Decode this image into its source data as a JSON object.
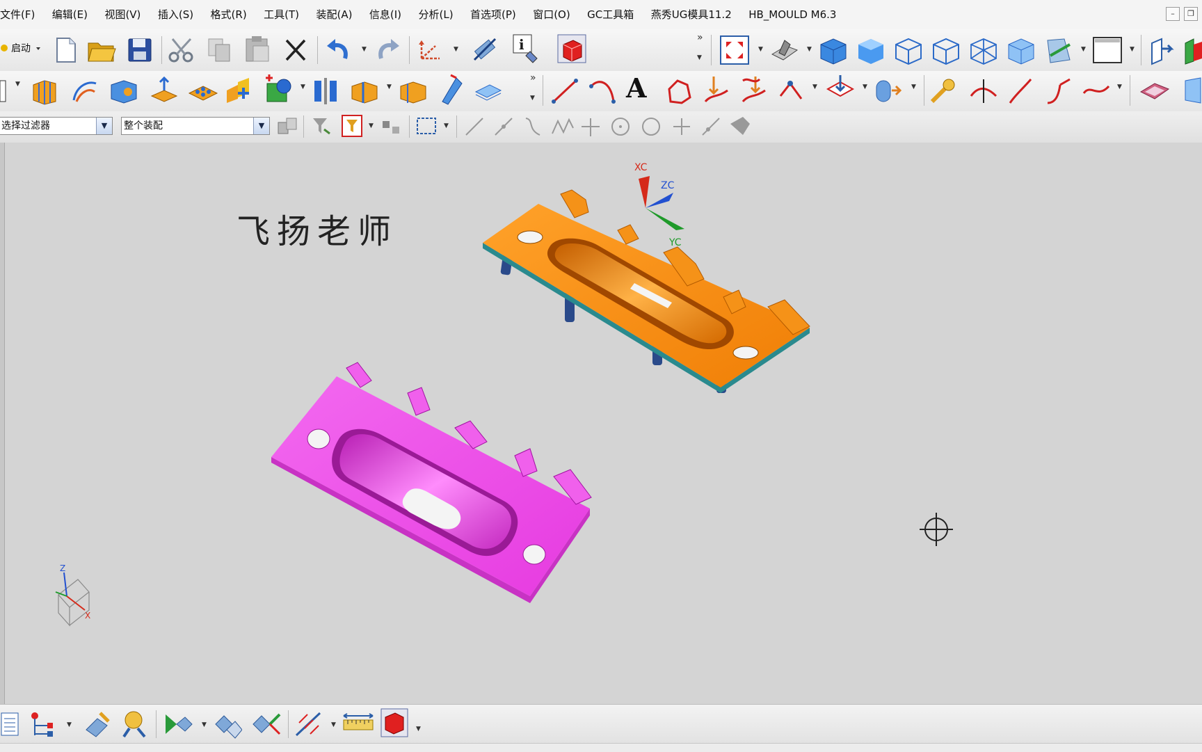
{
  "menu": {
    "items": [
      "文件(F)",
      "编辑(E)",
      "视图(V)",
      "插入(S)",
      "格式(R)",
      "工具(T)",
      "装配(A)",
      "信息(I)",
      "分析(L)",
      "首选项(P)",
      "窗口(O)",
      "GC工具箱",
      "燕秀UG模具11.2",
      "HB_MOULD M6.3"
    ]
  },
  "toolbar": {
    "start_label": "启动",
    "overflow_glyph": "»",
    "selection_filter": "选择过滤器",
    "assembly_scope": "整个装配",
    "text_tool_glyph": "A"
  },
  "viewport": {
    "watermark": "飞扬老师",
    "axes": {
      "xc": "XC",
      "yc": "YC",
      "zc": "ZC"
    },
    "mini_triad": {
      "z": "Z",
      "x": "X"
    },
    "parts": [
      {
        "name": "orange-insert",
        "color": "#f48f0b"
      },
      {
        "name": "magenta-insert",
        "color": "#ee4ee8"
      }
    ]
  },
  "statusbar": {
    "text": ""
  }
}
